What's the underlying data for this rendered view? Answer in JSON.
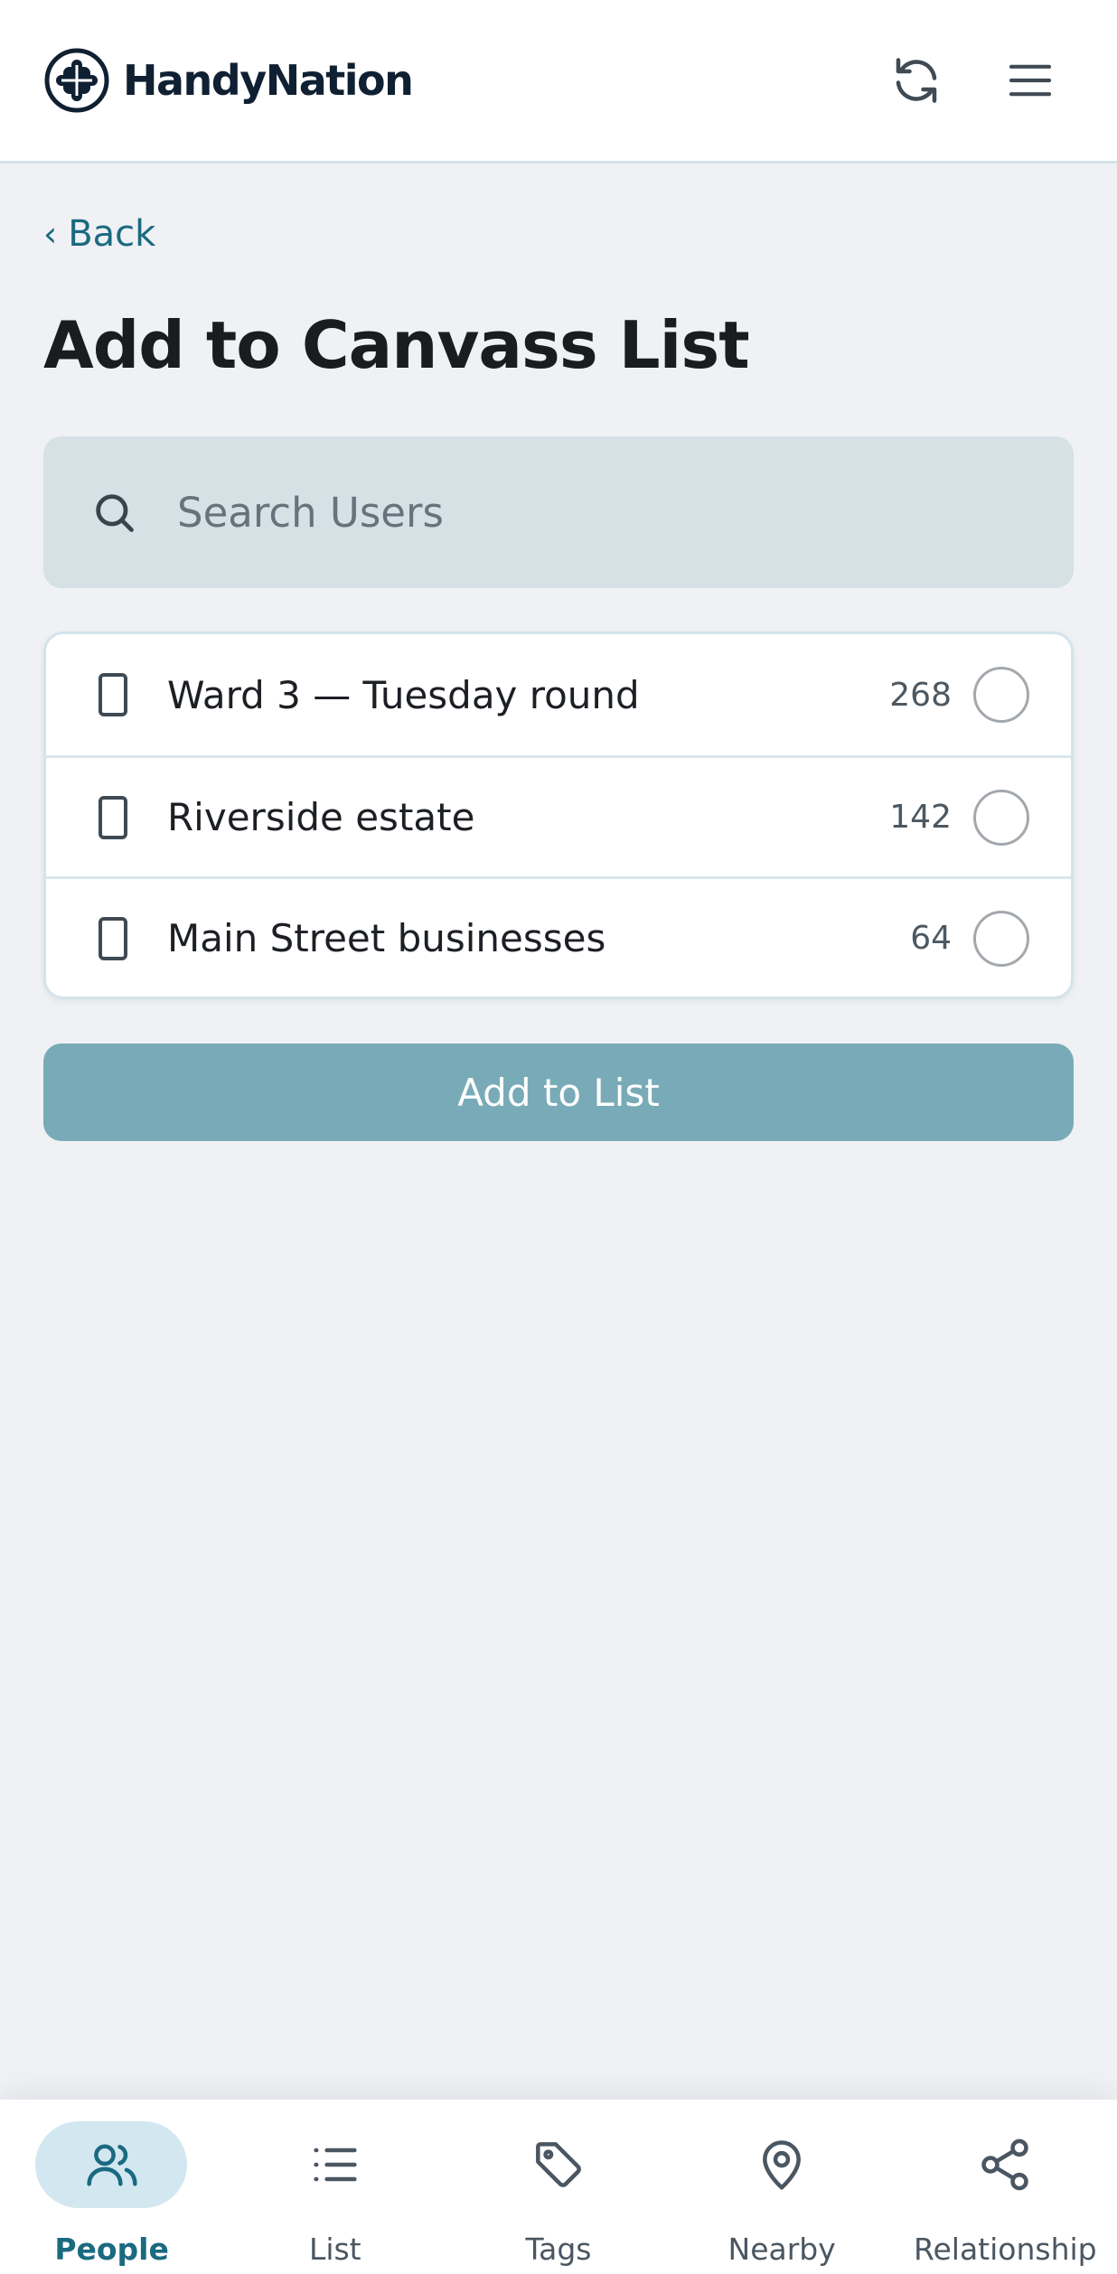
{
  "header": {
    "brand_name": "HandyNation",
    "icons": {
      "logo": "handynation-logo-icon",
      "refresh": "refresh-icon",
      "menu": "hamburger-menu-icon"
    }
  },
  "nav": {
    "back_label": "Back"
  },
  "page": {
    "title": "Add to Canvass List"
  },
  "search": {
    "placeholder": "Search Users",
    "value": ""
  },
  "lists": [
    {
      "label": "Ward 3 — Tuesday round",
      "count": "268",
      "selected": false
    },
    {
      "label": "Riverside estate",
      "count": "142",
      "selected": false
    },
    {
      "label": "Main Street businesses",
      "count": "64",
      "selected": false
    }
  ],
  "actions": {
    "add_label": "Add to List"
  },
  "bottom_nav": {
    "items": [
      {
        "label": "People",
        "icon": "people-icon",
        "active": true
      },
      {
        "label": "List",
        "icon": "list-icon",
        "active": false
      },
      {
        "label": "Tags",
        "icon": "tag-icon",
        "active": false
      },
      {
        "label": "Nearby",
        "icon": "location-pin-icon",
        "active": false
      },
      {
        "label": "Relationship",
        "icon": "share-nodes-icon",
        "active": false
      }
    ]
  },
  "colors": {
    "accent": "#1a6a80",
    "button": "#78abb7",
    "search_bg": "#d6e1e6",
    "page_bg": "#eff1f4",
    "nav_active_bg": "#d3e7f0"
  }
}
